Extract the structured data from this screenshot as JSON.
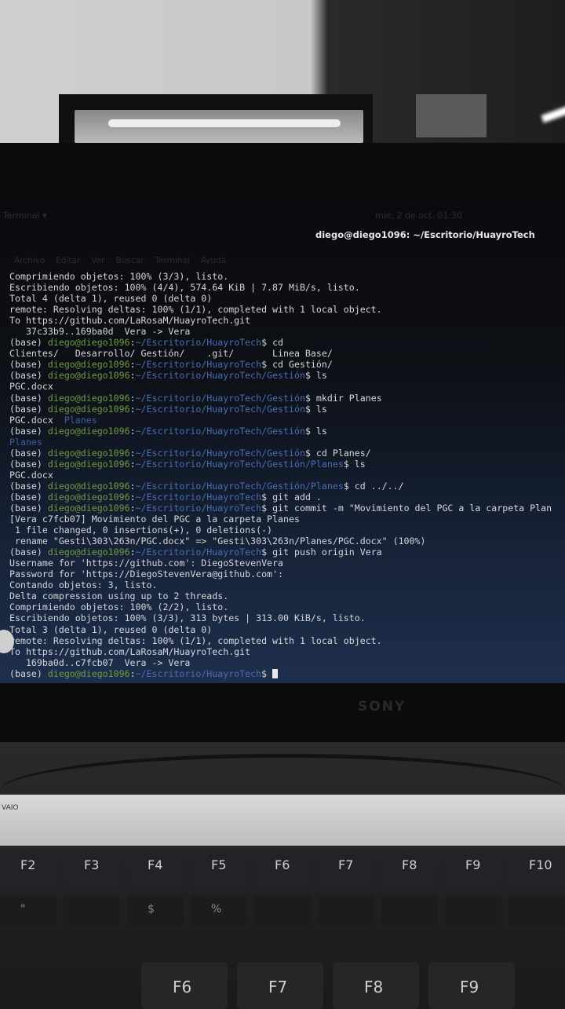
{
  "topbar": {
    "app_menu": "Terminal ▾",
    "clock": "mié, 2 de oct. 01:30"
  },
  "window": {
    "title": "diego@diego1096: ~/Escritorio/HuayroTech"
  },
  "menu": [
    "Archivo",
    "Editar",
    "Ver",
    "Buscar",
    "Terminal",
    "Ayuda"
  ],
  "colors": {
    "user": "#6f9b3f",
    "path": "#4a6db5",
    "text": "#d6d7dc",
    "directory": "#3f5e9e"
  },
  "prompt": {
    "env": "(base) ",
    "user": "diego@diego1096",
    "sep": ":"
  },
  "terminal_lines": [
    {
      "text": "Comprimiendo objetos: 100% (3/3), listo."
    },
    {
      "text": "Escribiendo objetos: 100% (4/4), 574.64 KiB | 7.87 MiB/s, listo."
    },
    {
      "text": "Total 4 (delta 1), reused 0 (delta 0)"
    },
    {
      "text": "remote: Resolving deltas: 100% (1/1), completed with 1 local object."
    },
    {
      "text": "To https://github.com/LaRosaM/HuayroTech.git"
    },
    {
      "text": "   37c33b9..169ba0d  Vera -> Vera"
    },
    {
      "path": "~/Escritorio/HuayroTech",
      "cmd": "$ cd"
    },
    {
      "text": "Clientes/   Desarrollo/ Gestión/    .git/       Linea Base/"
    },
    {
      "path": "~/Escritorio/HuayroTech",
      "cmd": "$ cd Gestión/"
    },
    {
      "path": "~/Escritorio/HuayroTech/Gestión",
      "cmd": "$ ls"
    },
    {
      "text": "PGC.docx"
    },
    {
      "path": "~/Escritorio/HuayroTech/Gestión",
      "cmd": "$ mkdir Planes"
    },
    {
      "path": "~/Escritorio/HuayroTech/Gestión",
      "cmd": "$ ls"
    },
    {
      "text": "PGC.docx  ",
      "dir": "Planes"
    },
    {
      "path": "~/Escritorio/HuayroTech/Gestión",
      "cmd": "$ ls"
    },
    {
      "text": "",
      "dir": "Planes"
    },
    {
      "path": "~/Escritorio/HuayroTech/Gestión",
      "cmd": "$ cd Planes/"
    },
    {
      "path": "~/Escritorio/HuayroTech/Gestión/Planes",
      "cmd": "$ ls"
    },
    {
      "text": "PGC.docx"
    },
    {
      "path": "~/Escritorio/HuayroTech/Gestión/Planes",
      "cmd": "$ cd ../../"
    },
    {
      "path": "~/Escritorio/HuayroTech",
      "cmd": "$ git add ."
    },
    {
      "path": "~/Escritorio/HuayroTech",
      "cmd": "$ git commit -m \"Movimiento del PGC a la carpeta Plan"
    },
    {
      "text": "[Vera c7fcb07] Movimiento del PGC a la carpeta Planes"
    },
    {
      "text": " 1 file changed, 0 insertions(+), 0 deletions(-)"
    },
    {
      "text": " rename \"Gesti\\303\\263n/PGC.docx\" => \"Gesti\\303\\263n/Planes/PGC.docx\" (100%)"
    },
    {
      "path": "~/Escritorio/HuayroTech",
      "cmd": "$ git push origin Vera"
    },
    {
      "text": "Username for 'https://github.com': DiegoStevenVera"
    },
    {
      "text": "Password for 'https://DiegoStevenVera@github.com':"
    },
    {
      "text": "Contando objetos: 3, listo."
    },
    {
      "text": "Delta compression using up to 2 threads."
    },
    {
      "text": "Comprimiendo objetos: 100% (2/2), listo."
    },
    {
      "text": "Escribiendo objetos: 100% (3/3), 313 bytes | 313.00 KiB/s, listo."
    },
    {
      "text": "Total 3 (delta 1), reused 0 (delta 0)"
    },
    {
      "text": "remote: Resolving deltas: 100% (1/1), completed with 1 local object."
    },
    {
      "text": "To https://github.com/LaRosaM/HuayroTech.git"
    },
    {
      "text": "   169ba0d..c7fcb07  Vera -> Vera"
    },
    {
      "path": "~/Escritorio/HuayroTech",
      "cmd": "$ ",
      "cursor": true
    }
  ],
  "laptop": {
    "brand": "SONY",
    "palmrest_logo": "VAIO"
  },
  "keyboard": {
    "function_row": [
      "F2",
      "F3",
      "F4",
      "F5",
      "F6",
      "F7",
      "F8",
      "F9",
      "F10"
    ],
    "number_row": [
      "\"",
      "",
      "$",
      "%",
      "",
      "",
      "",
      "",
      ""
    ],
    "foreground_row": [
      "F6",
      "F7",
      "F8",
      "F9"
    ]
  }
}
